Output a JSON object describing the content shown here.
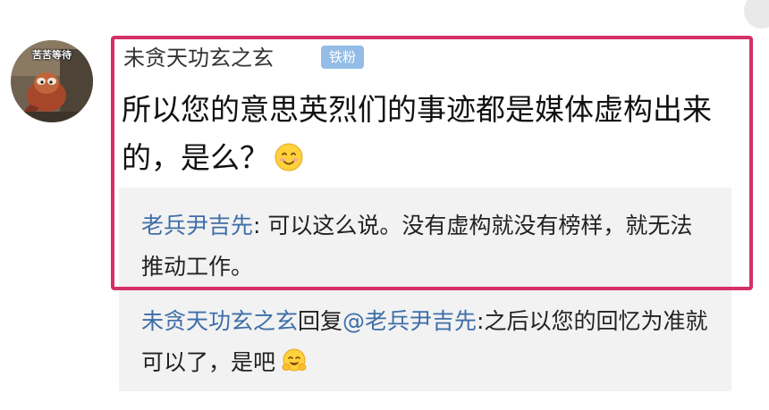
{
  "avatar": {
    "label": "苦苦等待"
  },
  "comment": {
    "username": "未贪天功玄之玄",
    "badge": "铁粉",
    "text": "所以您的意思英烈们的事迹都是媒体虚构出来的，是么？",
    "emoji": "smile-emoji"
  },
  "replies": [
    {
      "author": "老兵尹吉先",
      "separator": ":  ",
      "text": "可以这么说。没有虚构就没有榜样，就无法推动工作。"
    },
    {
      "author": "未贪天功玄之玄",
      "reply_word": "回复",
      "mention": "@老兵尹吉先",
      "separator": ":",
      "text": "之后以您的回忆为准就可以了，是吧",
      "emoji": "hug-emoji"
    }
  ],
  "colors": {
    "highlight": "#d4306a",
    "link_blue": "#3e6ea8",
    "badge_bg": "#93bde6",
    "reply_bg": "#f2f2f2"
  }
}
